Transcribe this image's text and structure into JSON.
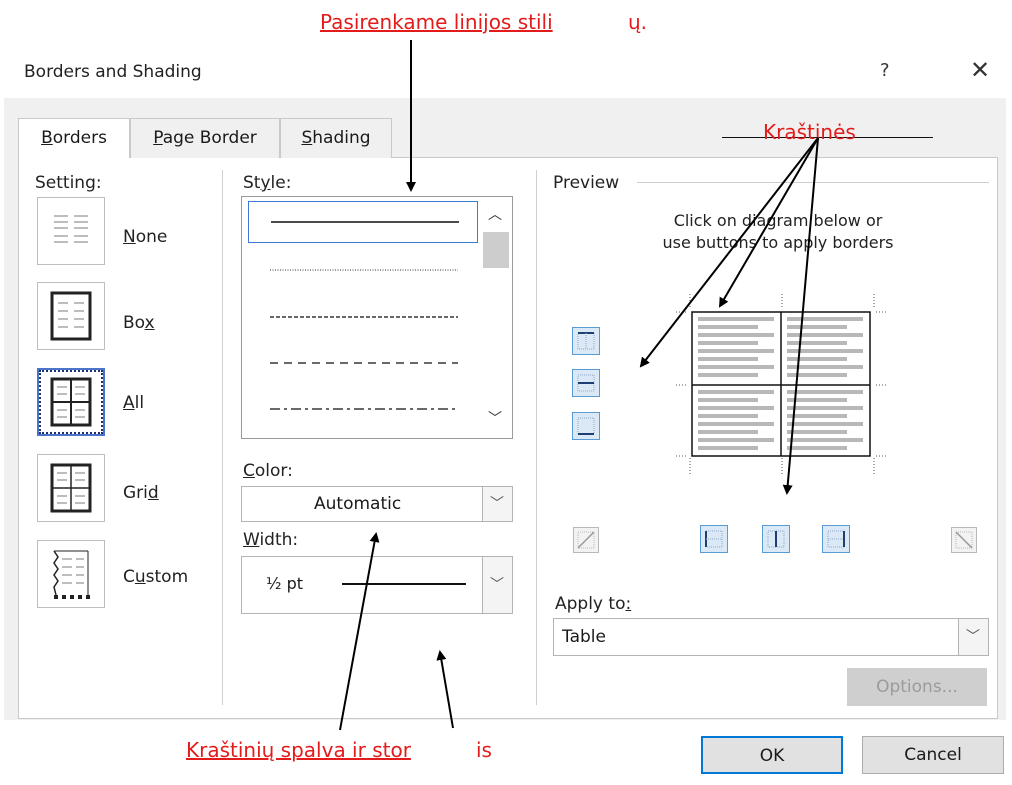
{
  "annotations": {
    "style_note": {
      "main": "Pasirenkame linijos stili",
      "tail": "ų."
    },
    "borders_note": "Kraštinės",
    "color_width_note": {
      "main": "Kraštinių spalva ir stor",
      "tail": "is"
    }
  },
  "window": {
    "title": "Borders and Shading",
    "help": "?",
    "close": "✕"
  },
  "tabs": [
    {
      "label": "Borders",
      "active": true
    },
    {
      "label": "Page Border",
      "active": false
    },
    {
      "label": "Shading",
      "active": false
    }
  ],
  "setting": {
    "label": "Setting:",
    "items": [
      {
        "label": "None",
        "icon": "setting-none-icon"
      },
      {
        "label": "Box",
        "icon": "setting-box-icon"
      },
      {
        "label": "All",
        "icon": "setting-all-icon",
        "selected": true
      },
      {
        "label": "Grid",
        "icon": "setting-grid-icon"
      },
      {
        "label": "Custom",
        "icon": "setting-custom-icon"
      }
    ]
  },
  "style": {
    "label": "Style:",
    "options": [
      "solid",
      "dotted",
      "dashed",
      "long-dashed",
      "dash-dot"
    ]
  },
  "color": {
    "label": "Color:",
    "value": "Automatic"
  },
  "width": {
    "label": "Width:",
    "value": "½ pt"
  },
  "preview": {
    "label": "Preview",
    "instructions_line1": "Click on diagram below or",
    "instructions_line2": "use buttons to apply borders"
  },
  "apply_to": {
    "label": "Apply to:",
    "value": "Table"
  },
  "buttons": {
    "options": "Options...",
    "ok": "OK",
    "cancel": "Cancel"
  },
  "colors": {
    "annotation": "#e41b1b",
    "accent": "#5b9bd5",
    "ok_border": "#0078d7"
  }
}
